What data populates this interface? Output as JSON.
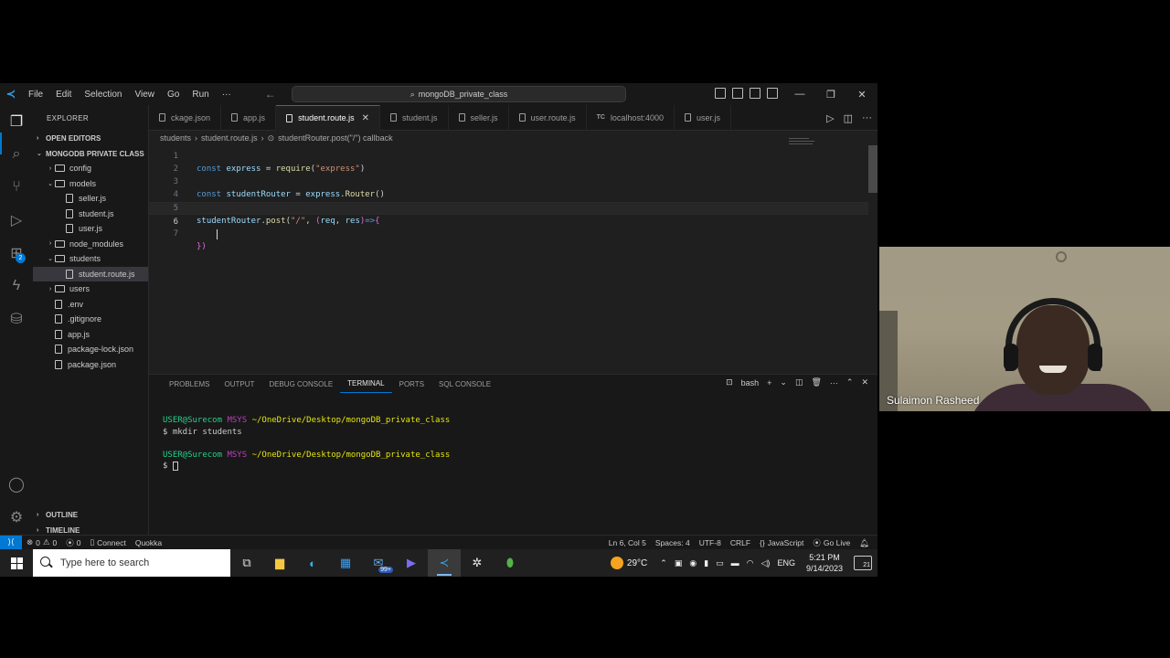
{
  "titlebar": {
    "menu": [
      "File",
      "Edit",
      "Selection",
      "View",
      "Go",
      "Run",
      "···"
    ],
    "search": "mongoDB_private_class",
    "controls": [
      "—",
      "❐",
      "✕"
    ]
  },
  "sidebar": {
    "header": "EXPLORER",
    "open_editors": "OPEN EDITORS",
    "project": "MONGODB PRIVATE CLASS",
    "tree": [
      {
        "label": "config",
        "type": "folder",
        "depth": 1,
        "chev": "›"
      },
      {
        "label": "models",
        "type": "folder",
        "depth": 1,
        "chev": "⌄"
      },
      {
        "label": "seller.js",
        "type": "file",
        "depth": 2,
        "chev": ""
      },
      {
        "label": "student.js",
        "type": "file",
        "depth": 2,
        "chev": ""
      },
      {
        "label": "user.js",
        "type": "file",
        "depth": 2,
        "chev": ""
      },
      {
        "label": "node_modules",
        "type": "folder",
        "depth": 1,
        "chev": "›"
      },
      {
        "label": "students",
        "type": "folder",
        "depth": 1,
        "chev": "⌄"
      },
      {
        "label": "student.route.js",
        "type": "file",
        "depth": 2,
        "chev": "",
        "selected": true
      },
      {
        "label": "users",
        "type": "folder",
        "depth": 1,
        "chev": "›"
      },
      {
        "label": ".env",
        "type": "file",
        "depth": 1,
        "chev": ""
      },
      {
        "label": ".gitignore",
        "type": "file",
        "depth": 1,
        "chev": ""
      },
      {
        "label": "app.js",
        "type": "file",
        "depth": 1,
        "chev": ""
      },
      {
        "label": "package-lock.json",
        "type": "file",
        "depth": 1,
        "chev": ""
      },
      {
        "label": "package.json",
        "type": "file",
        "depth": 1,
        "chev": ""
      }
    ],
    "outline": "OUTLINE",
    "timeline": "TIMELINE"
  },
  "tabs": [
    {
      "label": "ckage.json",
      "active": false
    },
    {
      "label": "app.js",
      "active": false
    },
    {
      "label": "student.route.js",
      "active": true
    },
    {
      "label": "student.js",
      "active": false
    },
    {
      "label": "seller.js",
      "active": false
    },
    {
      "label": "user.route.js",
      "active": false
    },
    {
      "label": "localhost:4000",
      "active": false,
      "tc": "TC"
    },
    {
      "label": "user.js",
      "active": false
    }
  ],
  "breadcrumb": {
    "folder": "students",
    "file": "student.route.js",
    "symbol": "studentRouter.post(\"/\") callback"
  },
  "editor": {
    "line_numbers": [
      "1",
      "2",
      "3",
      "4",
      "5",
      "6",
      "7"
    ],
    "current_line": 6
  },
  "panel": {
    "tabs": [
      "PROBLEMS",
      "OUTPUT",
      "DEBUG CONSOLE",
      "TERMINAL",
      "PORTS",
      "SQL CONSOLE"
    ],
    "active_tab": "TERMINAL",
    "shell": "bash",
    "terminal": {
      "user": "USER@Surecom",
      "env": "MSYS",
      "path": "~/OneDrive/Desktop/mongoDB_private_class",
      "command": "$ mkdir students",
      "prompt": "$"
    }
  },
  "statusbar": {
    "errors": "0",
    "warnings": "0",
    "ports": "0",
    "connect": "Connect",
    "quokka": "Quokka",
    "position": "Ln 6, Col 5",
    "spaces": "Spaces: 4",
    "encoding": "UTF-8",
    "eol": "CRLF",
    "language": "JavaScript",
    "golive": "Go Live"
  },
  "taskbar": {
    "search_placeholder": "Type here to search",
    "mail_badge": "99+",
    "temperature": "29°C",
    "language": "ENG",
    "time": "5:21 PM",
    "date": "9/14/2023",
    "notifications": "21"
  },
  "webcam": {
    "name": "Sulaimon Rasheed"
  },
  "colors": {
    "accent": "#0078d4",
    "keyword": "#569cd6",
    "variable": "#9cdcfe",
    "function": "#dcdcaa",
    "string": "#ce9178"
  }
}
